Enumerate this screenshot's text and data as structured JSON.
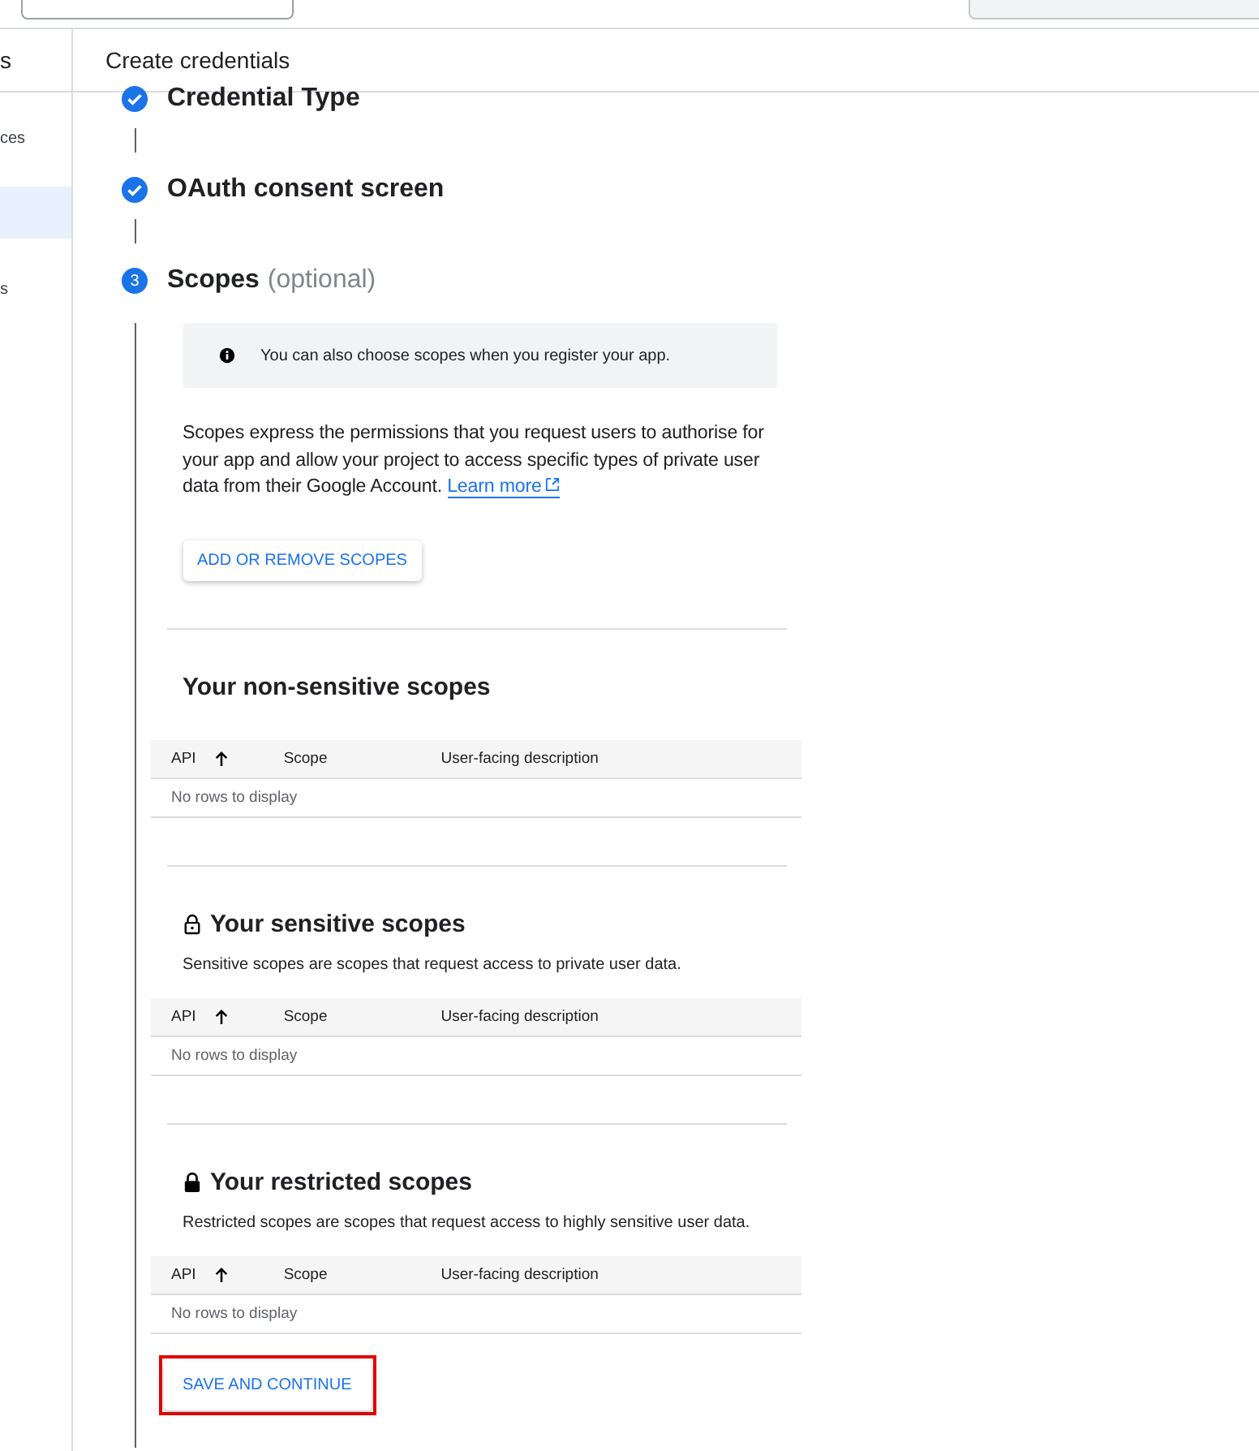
{
  "sidebar": {
    "header": "s",
    "items": [
      {
        "label": "ces",
        "selected": false
      },
      {
        "selected": true
      },
      {
        "label": "s",
        "selected": false
      }
    ]
  },
  "page_title": "Create credentials",
  "steps": [
    {
      "title": "Credential Type",
      "done": true
    },
    {
      "title": "OAuth consent screen",
      "done": true
    },
    {
      "number": "3",
      "title": "Scopes",
      "suffix": "(optional)",
      "done": false
    }
  ],
  "info_box": "You can also choose scopes when you register your app.",
  "description": "Scopes express the permissions that you request users to authorise for your app and allow your project to access specific types of private user data from their Google Account.",
  "learn_more": "Learn more",
  "add_button": "ADD OR REMOVE SCOPES",
  "sections": [
    {
      "kind": "plain",
      "title": "Your non-sensitive scopes",
      "table": {
        "columns": [
          "API",
          "Scope",
          "User-facing description"
        ],
        "empty_text": "No rows to display"
      }
    },
    {
      "kind": "sensitive",
      "title": "Your sensitive scopes",
      "description": "Sensitive scopes are scopes that request access to private user data.",
      "table": {
        "columns": [
          "API",
          "Scope",
          "User-facing description"
        ],
        "empty_text": "No rows to display"
      }
    },
    {
      "kind": "restricted",
      "title": "Your restricted scopes",
      "description": "Restricted scopes are scopes that request access to highly sensitive user data.",
      "table": {
        "columns": [
          "API",
          "Scope",
          "User-facing description"
        ],
        "empty_text": "No rows to display"
      }
    }
  ],
  "save_button": {
    "label": "SAVE AND CONTINUE",
    "highlighted": true
  }
}
